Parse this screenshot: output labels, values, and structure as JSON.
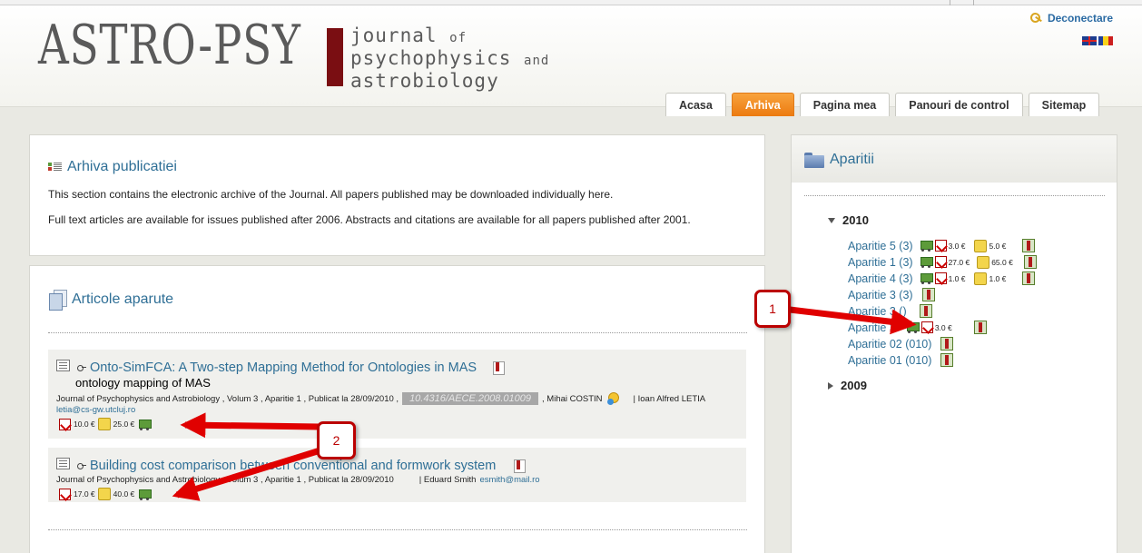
{
  "header": {
    "logo_main": "ASTRO-PSY",
    "logo_line1": "journal",
    "logo_line1_small": "of",
    "logo_line2": "psychophysics",
    "logo_line2_small": "and",
    "logo_line3": "astrobiology",
    "logout_label": "Deconectare"
  },
  "nav": {
    "tabs": [
      {
        "label": "Acasa",
        "active": false
      },
      {
        "label": "Arhiva",
        "active": true
      },
      {
        "label": "Pagina mea",
        "active": false
      },
      {
        "label": "Panouri de control",
        "active": false
      },
      {
        "label": "Sitemap",
        "active": false
      }
    ]
  },
  "archive": {
    "title": "Arhiva publicatiei",
    "text1": "This section contains the electronic archive of the Journal. All papers published may be downloaded individually here.",
    "text2": "Full text articles are available for issues published after 2006. Abstracts and citations are available for all papers published after 2001."
  },
  "articles": {
    "title": "Articole aparute",
    "items": [
      {
        "title": "Onto-SimFCA: A Two-step Mapping Method for Ontologies in MAS",
        "subtitle": "ontology mapping of MAS",
        "meta": "Journal of Psychophysics and Astrobiology , Volum 3 , Aparitie 1 , Publicat la 28/09/2010 ,",
        "doi": "10.4316/AECE.2008.01009",
        "author1": ", Mihai COSTIN",
        "author2": "| Ioan Alfred LETIA",
        "email": "letia@cs-gw.utcluj.ro",
        "price_pdf": "10.0 €",
        "price_note": "25.0 €"
      },
      {
        "title": "Building cost comparison between conventional and formwork system",
        "meta": "Journal of Psychophysics and Astrobiology , Volum 3 , Aparitie 1 , Publicat la 28/09/2010",
        "author1": "| Eduard Smith",
        "email": "esmith@mail.ro",
        "price_pdf": "17.0 €",
        "price_note": "40.0 €"
      }
    ]
  },
  "sidebar": {
    "title": "Aparitii",
    "years": [
      {
        "year": "2010",
        "expanded": true,
        "issues": [
          {
            "label": "Aparitie 5 (3)",
            "price_pdf": "3.0 €",
            "price_note": "5.0 €"
          },
          {
            "label": "Aparitie 1 (3)",
            "price_pdf": "27.0 €",
            "price_note": "65.0 €"
          },
          {
            "label": "Aparitie 4 (3)",
            "price_pdf": "1.0 €",
            "price_note": "1.0 €"
          },
          {
            "label": "Aparitie 3 (3)"
          },
          {
            "label": "Aparitie 3 ()"
          },
          {
            "label": "Aparitie 3",
            "price_pdf": "3.0 €"
          },
          {
            "label": "Aparitie 02 (010)"
          },
          {
            "label": "Aparitie 01 (010)"
          }
        ]
      },
      {
        "year": "2009",
        "expanded": false
      }
    ]
  },
  "callouts": [
    "1",
    "2"
  ],
  "colors": {
    "accent": "#ec7a10",
    "link": "#2f6f96",
    "callout": "#cc0000"
  }
}
